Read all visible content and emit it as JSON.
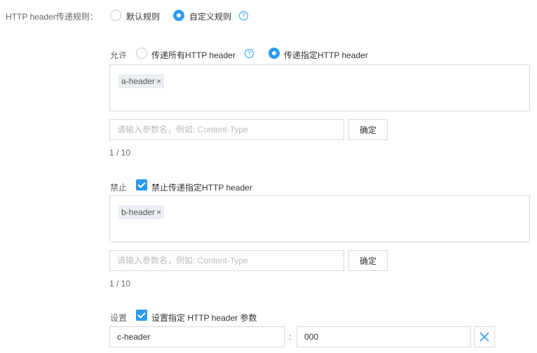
{
  "mode": {
    "label": "HTTP header传递规则：",
    "options": [
      "默认规则",
      "自定义规则"
    ],
    "selected": "自定义规则"
  },
  "allow": {
    "label": "允许",
    "options": [
      "传递所有HTTP header",
      "传递指定HTTP header"
    ],
    "selected": "传递指定HTTP header",
    "tags": [
      "a-header"
    ],
    "input_placeholder": "请输入参数名，例如: Content-Type",
    "confirm_label": "确定",
    "count": "1 / 10"
  },
  "deny": {
    "label": "禁止",
    "checkbox_label": "禁止传递指定HTTP header",
    "checked": true,
    "tags": [
      "b-header"
    ],
    "input_placeholder": "请输入参数名，例如: Content-Type",
    "confirm_label": "确定",
    "count": "1 / 10"
  },
  "set": {
    "label": "设置",
    "checkbox_label": "设置指定 HTTP header 参数",
    "checked": true,
    "rows": [
      {
        "name": "c-header",
        "separator": ":",
        "value": "000"
      }
    ]
  },
  "colors": {
    "accent": "#2b9af3",
    "border": "#d9d9d9",
    "tag_bg": "#ebeef3"
  },
  "icons": {
    "close": "×",
    "help": "?"
  }
}
